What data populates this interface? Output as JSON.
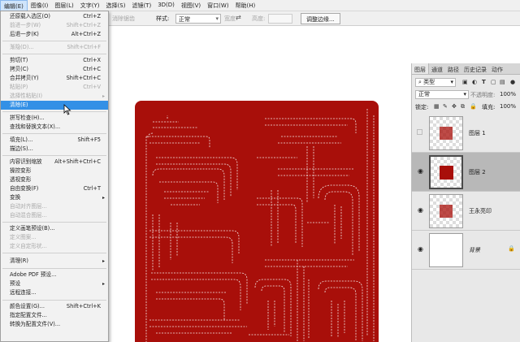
{
  "menubar": [
    "编辑(E)",
    "图像(I)",
    "图层(L)",
    "文字(Y)",
    "选择(S)",
    "滤镜(T)",
    "3D(D)",
    "视图(V)",
    "窗口(W)",
    "帮助(H)"
  ],
  "options_bar": {
    "dim_label": "消除锯齿",
    "style_label": "样式:",
    "style_value": "正常",
    "width_label": "宽度:",
    "height_label": "高度:",
    "refine_button": "调整边缘..."
  },
  "edit_menu": [
    {
      "label": "还原载入选区(O)",
      "shortcut": "Ctrl+Z",
      "disabled": false
    },
    {
      "label": "前进一步(W)",
      "shortcut": "Shift+Ctrl+Z",
      "disabled": true
    },
    {
      "label": "后退一步(K)",
      "shortcut": "Alt+Ctrl+Z",
      "disabled": false
    },
    {
      "label": "渐隐(D)...",
      "shortcut": "Shift+Ctrl+F",
      "disabled": true
    },
    {
      "label": "剪切(T)",
      "shortcut": "Ctrl+X",
      "disabled": false
    },
    {
      "label": "拷贝(C)",
      "shortcut": "Ctrl+C",
      "disabled": false
    },
    {
      "label": "合并拷贝(Y)",
      "shortcut": "Shift+Ctrl+C",
      "disabled": false
    },
    {
      "label": "粘贴(P)",
      "shortcut": "Ctrl+V",
      "disabled": true
    },
    {
      "label": "选择性粘贴(I)",
      "shortcut": "",
      "disabled": true,
      "submenu": true
    },
    {
      "label": "清除(E)",
      "shortcut": "",
      "disabled": false,
      "highlighted": true
    },
    {
      "label": "拼写检查(H)...",
      "shortcut": "",
      "disabled": false
    },
    {
      "label": "查找和替换文本(X)...",
      "shortcut": "",
      "disabled": false
    },
    {
      "label": "填充(L)...",
      "shortcut": "Shift+F5",
      "disabled": false
    },
    {
      "label": "描边(S)...",
      "shortcut": "",
      "disabled": false
    },
    {
      "label": "内容识别缩放",
      "shortcut": "Alt+Shift+Ctrl+C",
      "disabled": false
    },
    {
      "label": "操控变形",
      "shortcut": "",
      "disabled": false
    },
    {
      "label": "透视变形",
      "shortcut": "",
      "disabled": false
    },
    {
      "label": "自由变换(F)",
      "shortcut": "Ctrl+T",
      "disabled": false
    },
    {
      "label": "变换",
      "shortcut": "",
      "disabled": false,
      "submenu": true
    },
    {
      "label": "自动对齐图层...",
      "shortcut": "",
      "disabled": true
    },
    {
      "label": "自动混合图层...",
      "shortcut": "",
      "disabled": true
    },
    {
      "label": "定义画笔预设(B)...",
      "shortcut": "",
      "disabled": false
    },
    {
      "label": "定义图案...",
      "shortcut": "",
      "disabled": true
    },
    {
      "label": "定义自定形状...",
      "shortcut": "",
      "disabled": true
    },
    {
      "label": "清理(R)",
      "shortcut": "",
      "disabled": false,
      "submenu": true
    },
    {
      "label": "Adobe PDF 预设...",
      "shortcut": "",
      "disabled": false
    },
    {
      "label": "预设",
      "shortcut": "",
      "disabled": false,
      "submenu": true
    },
    {
      "label": "远程连接...",
      "shortcut": "",
      "disabled": false
    },
    {
      "label": "颜色设置(G)...",
      "shortcut": "Shift+Ctrl+K",
      "disabled": false
    },
    {
      "label": "指定配置文件...",
      "shortcut": "",
      "disabled": false
    },
    {
      "label": "转换为配置文件(V)...",
      "shortcut": "",
      "disabled": false
    }
  ],
  "layers_panel": {
    "tabs": [
      "图层",
      "通道",
      "路径",
      "历史记录",
      "动作"
    ],
    "kind_filter": "类型",
    "blend_mode": "正常",
    "opacity_label": "不透明度:",
    "opacity_value": "100%",
    "lock_label": "锁定:",
    "fill_label": "填充:",
    "fill_value": "100%",
    "layers": [
      {
        "name": "图层 1",
        "visible": false,
        "selected": false
      },
      {
        "name": "图层 2",
        "visible": true,
        "selected": true
      },
      {
        "name": "王永亮印",
        "visible": true,
        "selected": false
      },
      {
        "name": "背景",
        "visible": true,
        "selected": false,
        "locked": true
      }
    ]
  }
}
